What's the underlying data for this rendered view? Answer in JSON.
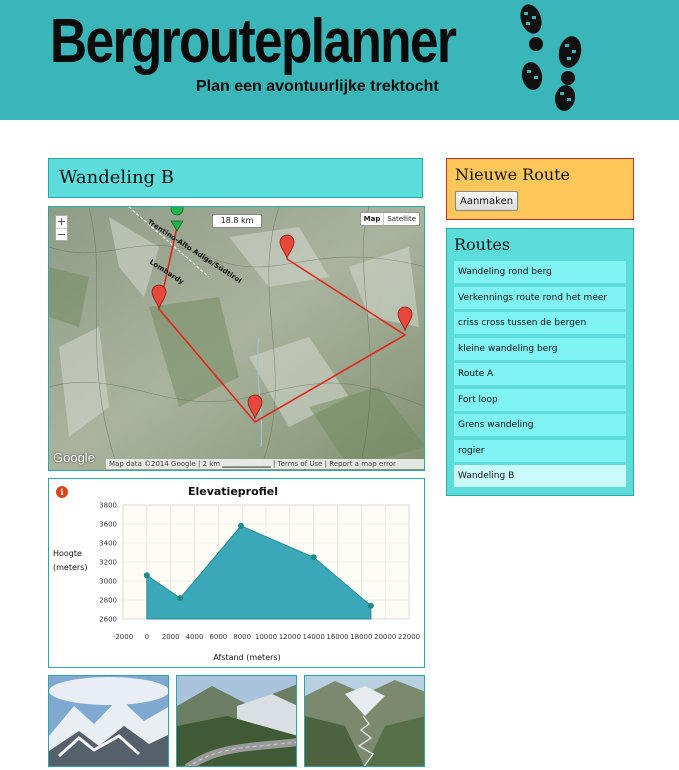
{
  "header": {
    "title": "Bergrouteplanner",
    "subtitle": "Plan een avontuurlijke trektocht"
  },
  "route": {
    "name": "Wandeling B"
  },
  "map": {
    "zoom_in": "+",
    "zoom_out": "−",
    "distance": "18.8 km",
    "type_map": "Map",
    "type_satellite": "Satellite",
    "region_label_1": "Trentino-Alto Adige/Südtirol",
    "region_label_2": "Lombardy",
    "google_logo": "Google",
    "footer": "Map data ©2014 Google  |  2 km  ▁▁▁▁▁▁▁▁▁  |  Terms of Use  |  Report a map error"
  },
  "elevation": {
    "info_icon": "i",
    "chart_data": {
      "type": "area",
      "title": "Elevatieprofiel",
      "xlabel": "Afstand (meters)",
      "ylabel_line1": "Hoogte",
      "ylabel_line2": "(meters)",
      "xlim": [
        -2000,
        22000
      ],
      "ylim": [
        2600,
        3800
      ],
      "x_ticks": [
        -2000,
        0,
        2000,
        4000,
        6000,
        8000,
        10000,
        12000,
        14000,
        16000,
        18000,
        20000,
        22000
      ],
      "y_ticks": [
        2600,
        2800,
        3000,
        3200,
        3400,
        3600,
        3800
      ],
      "x": [
        0,
        2800,
        7900,
        14000,
        18800
      ],
      "y": [
        3060,
        2820,
        3580,
        3250,
        2740
      ],
      "color": "#3aa8b8"
    }
  },
  "sidebar": {
    "new_route_title": "Nieuwe Route",
    "create_button": "Aanmaken",
    "routes_title": "Routes",
    "routes": [
      "Wandeling rond berg",
      "Verkennings route rond het meer",
      "criss cross tussen de bergen",
      "kleine wandeling berg",
      "Route A",
      "Fort loop",
      "Grens wandeling",
      "rogier",
      "Wandeling B"
    ],
    "active_index": 8
  }
}
